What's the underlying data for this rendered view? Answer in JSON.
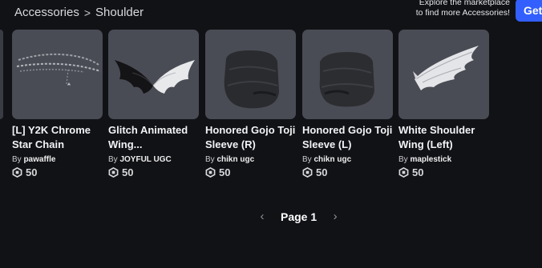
{
  "breadcrumb": {
    "parent": "Accessories",
    "separator": ">",
    "current": "Shoulder"
  },
  "promo": {
    "line1": "Explore the marketplace",
    "line2": "to find more Accessories!",
    "button_label": "Get"
  },
  "items": [
    {
      "name": "[L] Y2K Chrome Star Chain",
      "by": "By",
      "creator": "pawaffle",
      "price": "50"
    },
    {
      "name": "Glitch Animated Wing...",
      "by": "By",
      "creator": "JOYFUL UGC",
      "price": "50"
    },
    {
      "name": "Honored Gojo Toji Sleeve (R)",
      "by": "By",
      "creator": "chikn ugc",
      "price": "50"
    },
    {
      "name": "Honored Gojo Toji Sleeve (L)",
      "by": "By",
      "creator": "chikn ugc",
      "price": "50"
    },
    {
      "name": "White Shoulder Wing (Left)",
      "by": "By",
      "creator": "maplestick",
      "price": "50"
    }
  ],
  "pagination": {
    "label": "Page 1",
    "prev_icon": "chevron-left-icon",
    "next_icon": "chevron-right-icon"
  },
  "colors": {
    "background": "#111216",
    "card_thumb": "#4a4c55",
    "accent": "#335fff"
  }
}
